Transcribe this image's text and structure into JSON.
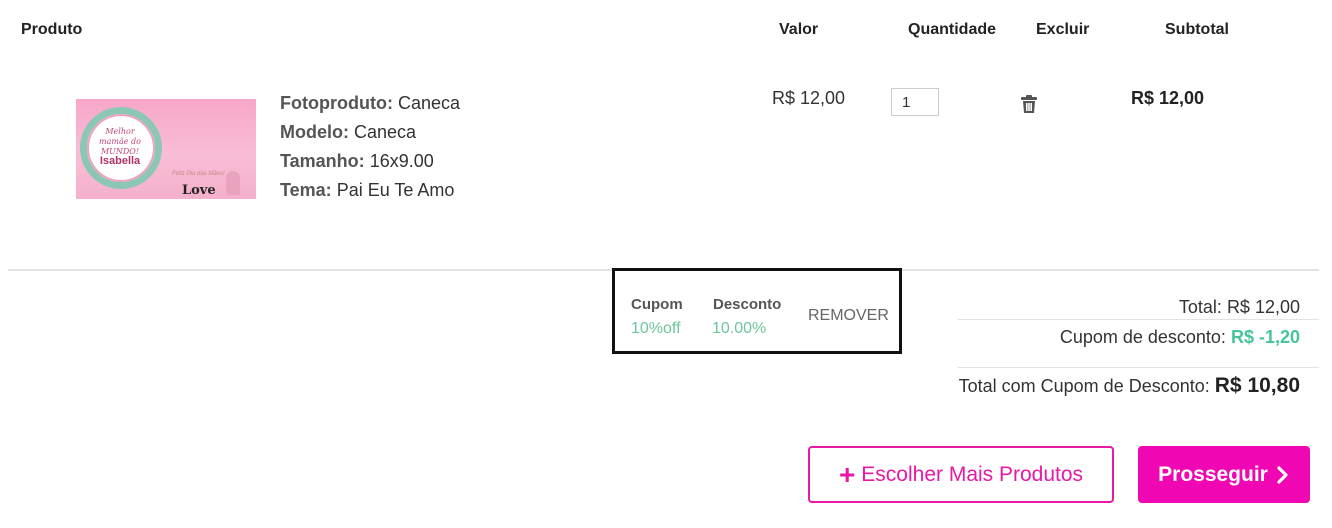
{
  "headers": {
    "produto": "Produto",
    "valor": "Valor",
    "quantidade": "Quantidade",
    "excluir": "Excluir",
    "subtotal": "Subtotal"
  },
  "item": {
    "thumbnail": {
      "line1": "Melhor mamãe do MUNDO!",
      "name": "Isabella",
      "tagline": "Feliz Dia das Mães!",
      "love": "Love"
    },
    "details": [
      {
        "label": "Fotoproduto:",
        "value": "Caneca"
      },
      {
        "label": "Modelo:",
        "value": "Caneca"
      },
      {
        "label": "Tamanho:",
        "value": "16x9.00"
      },
      {
        "label": "Tema:",
        "value": "Pai Eu Te Amo"
      }
    ],
    "valor": "R$ 12,00",
    "quantidade": "1",
    "delete_icon": "trash-icon",
    "subtotal": "R$ 12,00"
  },
  "coupon": {
    "cupom_label": "Cupom",
    "cupom_value": "10%off",
    "desconto_label": "Desconto",
    "desconto_value": "10.00%",
    "remove_label": "REMOVER"
  },
  "totals": {
    "total_label": "Total:",
    "total_value": "R$ 12,00",
    "discount_label": "Cupom de desconto:",
    "discount_value": "R$ -1,20",
    "final_label": "Total com Cupom de Desconto:",
    "final_value": "R$ 10,80"
  },
  "actions": {
    "more_label": "Escolher Mais Produtos",
    "more_icon": "plus-icon",
    "next_label": "Prosseguir",
    "next_icon": "chevron-right-icon"
  },
  "colors": {
    "accent": "#f007b3",
    "discount_green": "#46c49a"
  }
}
